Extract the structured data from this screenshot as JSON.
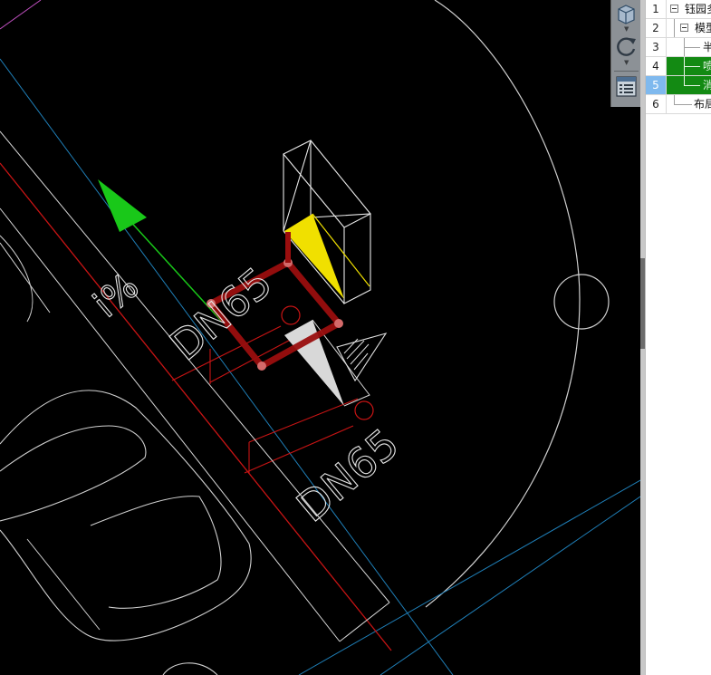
{
  "drawing": {
    "pipe_label_upper": "DN65",
    "pipe_label_lower": "DN65",
    "slope_label": "i%"
  },
  "view_toolbar": {
    "buttons": [
      "view-cube-icon",
      "rotate-view-icon",
      "view-properties-icon"
    ]
  },
  "tree_panel": {
    "rows": [
      {
        "num": "1",
        "label": "钰园多",
        "expander": true,
        "highlight": false,
        "active": false
      },
      {
        "num": "2",
        "label": "模型",
        "expander": true,
        "highlight": false,
        "active": false
      },
      {
        "num": "3",
        "label": "半",
        "expander": false,
        "highlight": false,
        "active": false
      },
      {
        "num": "4",
        "label": "喷",
        "expander": false,
        "highlight": true,
        "active": false
      },
      {
        "num": "5",
        "label": "消",
        "expander": false,
        "highlight": true,
        "active": true
      },
      {
        "num": "6",
        "label": "布局",
        "expander": false,
        "highlight": false,
        "active": false
      }
    ]
  },
  "colors": {
    "background": "#000000",
    "pipe_red": "#c81414",
    "axis_blue": "#1f7fb8",
    "axis_green": "#19c819",
    "highlight_green": "#138a13",
    "selected_row": "#7fb9ee",
    "yellow_face": "#f0e000"
  }
}
